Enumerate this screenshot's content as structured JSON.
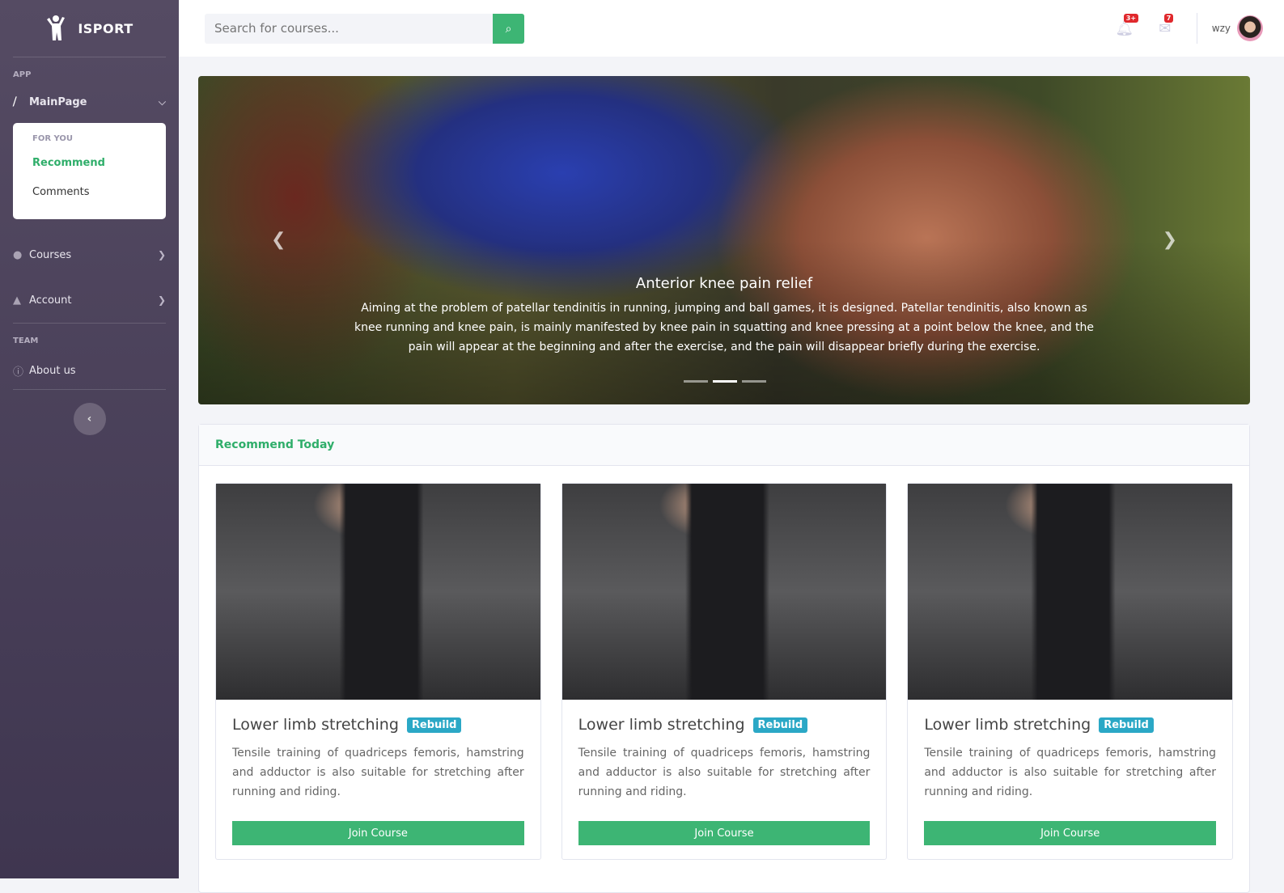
{
  "sidebar": {
    "brand": "ISPORT",
    "section_app": "APP",
    "mainpage": "MainPage",
    "submenu": {
      "header": "FOR YOU",
      "items": [
        "Recommend",
        "Comments"
      ]
    },
    "courses": "Courses",
    "account": "Account",
    "section_team": "TEAM",
    "about": "About us"
  },
  "topbar": {
    "search_placeholder": "Search for courses...",
    "notifications_badge": "3+",
    "messages_badge": "7",
    "username": "wzy"
  },
  "hero": {
    "title": "Anterior knee pain relief",
    "text": "Aiming at the problem of patellar tendinitis in running, jumping and ball games, it is designed. Patellar tendinitis, also known as knee running and knee pain, is mainly manifested by knee pain in squatting and knee pressing at a point below the knee, and the pain will appear at the beginning and after the exercise, and the pain will disappear briefly during the exercise.",
    "active_slide": 2,
    "slide_count": 3
  },
  "recommend": {
    "title": "Recommend Today",
    "cards": [
      {
        "title": "Lower limb stretching",
        "tag": "Rebuild",
        "desc": "Tensile training of quadriceps femoris, hamstring and adductor is also suitable for stretching after running and riding.",
        "button": "Join Course"
      },
      {
        "title": "Lower limb stretching",
        "tag": "Rebuild",
        "desc": "Tensile training of quadriceps femoris, hamstring and adductor is also suitable for stretching after running and riding.",
        "button": "Join Course"
      },
      {
        "title": "Lower limb stretching",
        "tag": "Rebuild",
        "desc": "Tensile training of quadriceps femoris, hamstring and adductor is also suitable for stretching after running and riding.",
        "button": "Join Course"
      }
    ]
  },
  "colors": {
    "accent": "#3db574",
    "tag": "#2ba8c6",
    "badge": "#e0282c"
  }
}
